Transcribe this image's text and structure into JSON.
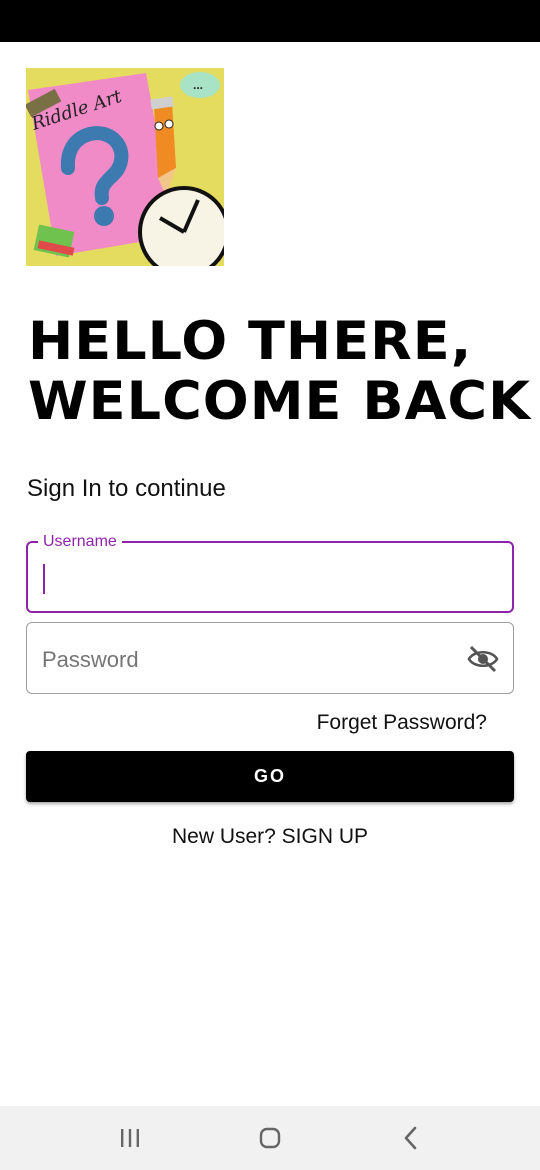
{
  "logo": {
    "text": "Riddle Art",
    "icon": "riddle-art-logo"
  },
  "headline": {
    "line1": "HELLO THERE,",
    "line2": "WELCOME BACK"
  },
  "subtitle": "Sign In to continue",
  "username_field": {
    "label": "Username",
    "value": ""
  },
  "password_field": {
    "placeholder": "Password",
    "value": "",
    "icon": "visibility-off-icon"
  },
  "forgot_password": "Forget Password?",
  "go_button": "GO",
  "signup": "New User? SIGN UP",
  "colors": {
    "accent": "#8e24aa",
    "button": "#000000",
    "logo_bg": "#e3dc5e"
  }
}
